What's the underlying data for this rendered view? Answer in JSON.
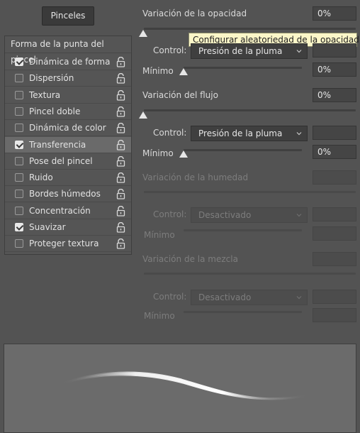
{
  "header": {
    "pinceles_button": "Pinceles"
  },
  "brush_list": {
    "header": "Forma de la punta del pincel",
    "items": [
      {
        "label": "Dinámica de forma",
        "checked": true,
        "selected": false
      },
      {
        "label": "Dispersión",
        "checked": false,
        "selected": false
      },
      {
        "label": "Textura",
        "checked": false,
        "selected": false
      },
      {
        "label": "Pincel doble",
        "checked": false,
        "selected": false
      },
      {
        "label": "Dinámica de color",
        "checked": false,
        "selected": false
      },
      {
        "label": "Transferencia",
        "checked": true,
        "selected": true
      },
      {
        "label": "Pose del pincel",
        "checked": false,
        "selected": false
      },
      {
        "label": "Ruido",
        "checked": false,
        "selected": false
      },
      {
        "label": "Bordes húmedos",
        "checked": false,
        "selected": false
      },
      {
        "label": "Concentración",
        "checked": false,
        "selected": false
      },
      {
        "label": "Suavizar",
        "checked": true,
        "selected": false
      },
      {
        "label": "Proteger textura",
        "checked": false,
        "selected": false
      }
    ]
  },
  "opacity": {
    "label": "Variación de la opacidad",
    "value": "0%",
    "control_label": "Control:",
    "control_value": "Presión de la pluma",
    "minimum_label": "Mínimo",
    "minimum_value": "0%"
  },
  "tooltip": "Configurar aleatoriedad de la opacidad",
  "flow": {
    "label": "Variación del flujo",
    "value": "0%",
    "control_label": "Control:",
    "control_value": "Presión de la pluma",
    "minimum_label": "Mínimo",
    "minimum_value": "0%"
  },
  "wetness": {
    "label": "Variación de la humedad",
    "control_label": "Control:",
    "control_value": "Desactivado",
    "minimum_label": "Mínimo"
  },
  "mix": {
    "label": "Variación de la mezcla",
    "control_label": "Control:",
    "control_value": "Desactivado",
    "minimum_label": "Mínimo"
  },
  "icons": {
    "lock": "lock-open-icon",
    "chevron": "chevron-down-icon"
  },
  "colors": {
    "panel_bg": "#535353",
    "selected_row": "#6a6a6a",
    "tooltip_bg": "#fbf6c8"
  }
}
